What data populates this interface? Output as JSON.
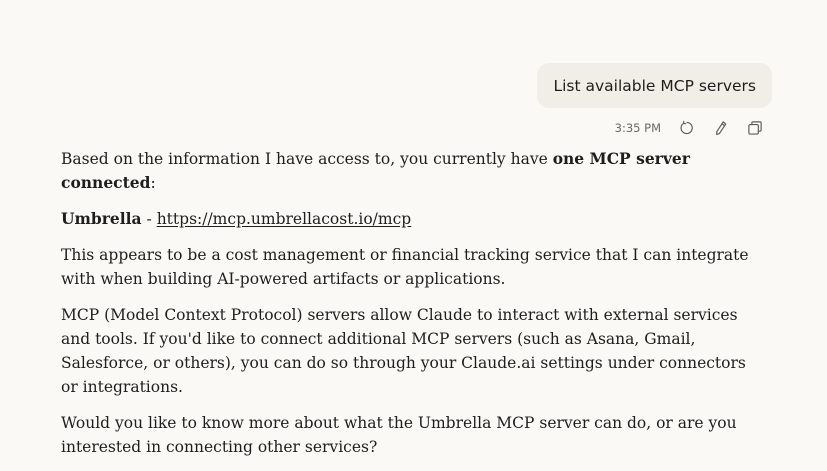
{
  "user_message": {
    "text": "List available MCP servers"
  },
  "meta": {
    "timestamp": "3:35 PM",
    "icons": [
      "retry-icon",
      "edit-icon",
      "copy-icon"
    ]
  },
  "response": {
    "p1_prefix": "Based on the information I have access to, you currently have ",
    "p1_bold": "one MCP server connected",
    "p1_suffix": ":",
    "server_name": "Umbrella",
    "server_sep": " - ",
    "server_url": "https://mcp.umbrellacost.io/mcp",
    "p3": "This appears to be a cost management or financial tracking service that I can integrate with when building AI-powered artifacts or applications.",
    "p4": "MCP (Model Context Protocol) servers allow Claude to interact with external services and tools. If you'd like to connect additional MCP servers (such as Asana, Gmail, Salesforce, or others), you can do so through your Claude.ai settings under connectors or integrations.",
    "p5": "Would you like to know more about what the Umbrella MCP server can do, or are you interested in connecting other services?"
  }
}
